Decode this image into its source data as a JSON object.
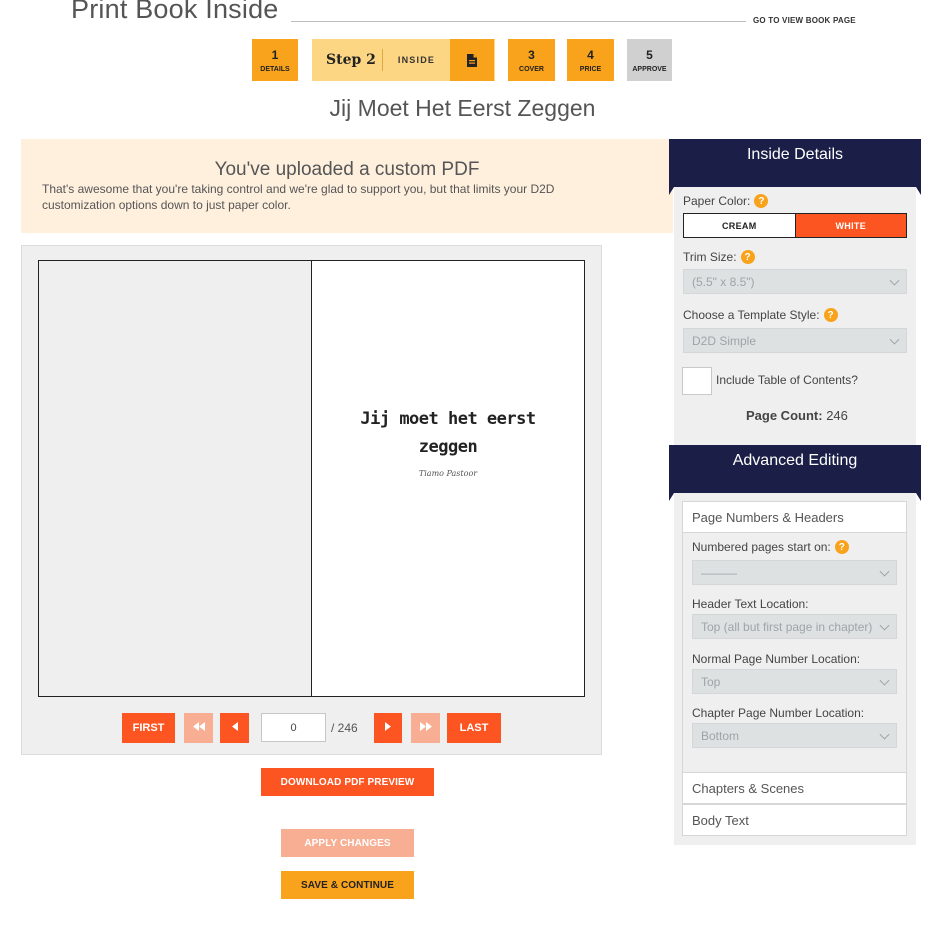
{
  "header": {
    "title": "Print Book Inside",
    "view_link": "GO TO VIEW BOOK PAGE"
  },
  "steps": [
    {
      "num": "1",
      "label": "DETAILS"
    },
    {
      "num": "Step 2",
      "label": "INSIDE",
      "icon": "document-icon"
    },
    {
      "num": "3",
      "label": "COVER"
    },
    {
      "num": "4",
      "label": "PRICE"
    },
    {
      "num": "5",
      "label": "APPROVE"
    }
  ],
  "book_title": "Jij Moet Het Eerst Zeggen",
  "notice": {
    "heading": "You've uploaded a custom PDF",
    "text": "That's awesome that you're taking control and we're glad to support you, but that limits your D2D customization options down to just paper color."
  },
  "preview": {
    "pdf_title": "Jij moet het eerst zeggen",
    "pdf_author": "Tiamo Pastoor",
    "nav": {
      "first": "FIRST",
      "last": "LAST",
      "page_value": "0",
      "page_total": "/ 246"
    },
    "download_label": "DOWNLOAD PDF PREVIEW",
    "apply_label": "APPLY CHANGES",
    "save_label": "SAVE & CONTINUE"
  },
  "inside_details": {
    "heading": "Inside Details",
    "paper_color_label": "Paper Color:",
    "paper_options": [
      "CREAM",
      "WHITE"
    ],
    "paper_selected": "WHITE",
    "trim_label": "Trim Size:",
    "trim_value": "(5.5\" x 8.5\")",
    "template_label": "Choose a Template Style:",
    "template_value": "D2D Simple",
    "toc_label": "Include Table of Contents?",
    "page_count_label": "Page Count:",
    "page_count_value": "246"
  },
  "advanced": {
    "heading": "Advanced Editing",
    "section_numbers": "Page Numbers & Headers",
    "numbered_start_label": "Numbered pages start on:",
    "numbered_start_value": "———",
    "header_loc_label": "Header Text Location:",
    "header_loc_value": "Top (all but first page in chapter)",
    "normal_num_label": "Normal Page Number Location:",
    "normal_num_value": "Top",
    "chapter_num_label": "Chapter Page Number Location:",
    "chapter_num_value": "Bottom",
    "section_chapters": "Chapters & Scenes",
    "section_body": "Body Text"
  },
  "colors": {
    "orange": "#fd5521",
    "amber": "#f9a21b",
    "navy": "#1b1f47"
  }
}
